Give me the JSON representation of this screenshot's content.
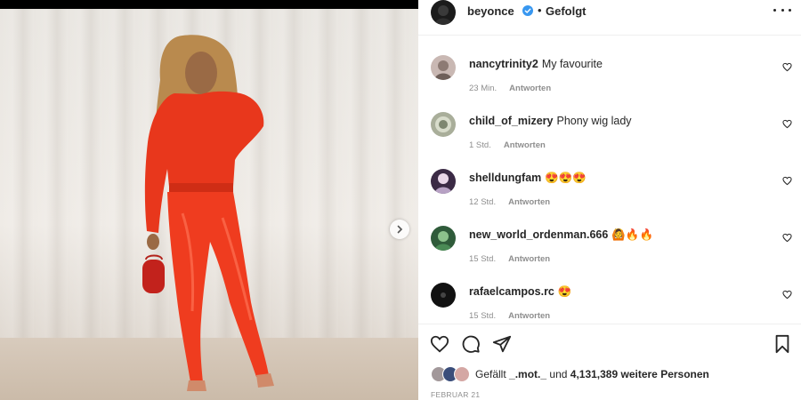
{
  "post": {
    "username": "beyonce",
    "separator": "•",
    "follow_status": "Gefolgt",
    "date": "FEBRUAR 21"
  },
  "comments": [
    {
      "user": "nancytrinity2",
      "text": "My favourite",
      "time": "23 Min.",
      "reply": "Antworten"
    },
    {
      "user": "child_of_mizery",
      "text": "Phony wig lady",
      "time": "1 Std.",
      "reply": "Antworten"
    },
    {
      "user": "shelldungfam",
      "text": "😍😍😍",
      "time": "12 Std.",
      "reply": "Antworten"
    },
    {
      "user": "new_world_ordenman.666",
      "text": "🙆🔥🔥",
      "time": "15 Std.",
      "reply": "Antworten"
    },
    {
      "user": "rafaelcampos.rc",
      "text": "😍",
      "time": "15 Std.",
      "reply": "Antworten"
    }
  ],
  "likes": {
    "prefix": "Gefällt",
    "user": "_.mot._",
    "middle": "und",
    "count": "4,131,389",
    "suffix": "weitere Personen"
  },
  "icons": {
    "verified": "verified-badge-icon",
    "more": "more-options-icon",
    "like": "heart-icon",
    "comment": "comment-bubble-icon",
    "share": "paper-plane-icon",
    "save": "bookmark-icon",
    "next": "chevron-right-icon"
  },
  "colors": {
    "verified": "#3897f0",
    "outfit": "#e8371c",
    "secondary_text": "#8e8e8e"
  }
}
